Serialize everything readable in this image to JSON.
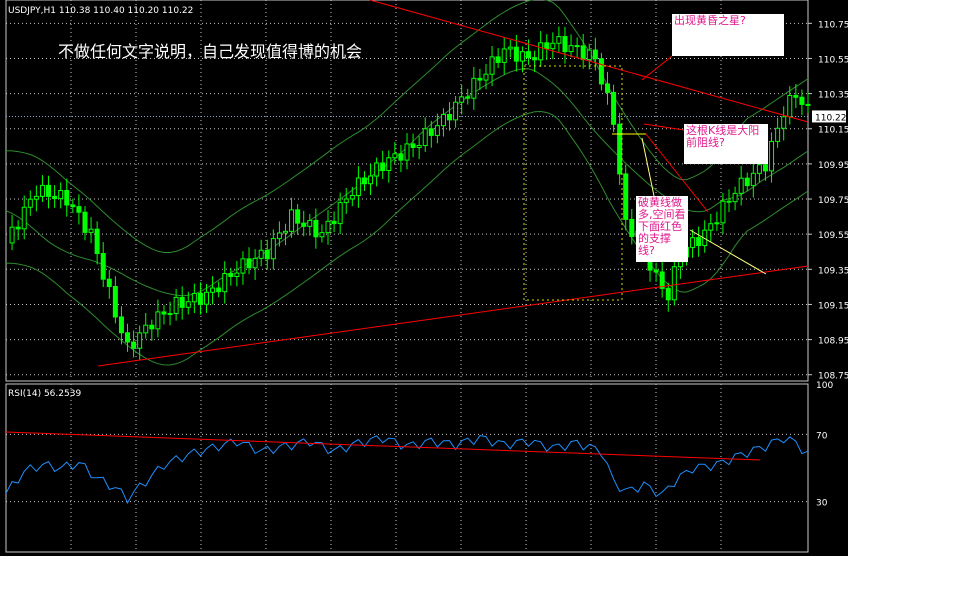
{
  "symbol_header": "USDJPY,H1  110.38 110.40 110.20 110.22",
  "headline": "不做任何文字说明，自己发现值得博的机会",
  "annotations": {
    "evening_star": "出现黄昏之星?",
    "resistance": "这根K线是大阳前阻线?",
    "support_break": "破黄线做多,空间看下面红色的支撑线?"
  },
  "price_axis": {
    "ticks": [
      "110.75",
      "110.55",
      "110.35",
      "110.15",
      "109.95",
      "109.75",
      "109.55",
      "109.35",
      "109.15",
      "108.95",
      "108.75"
    ],
    "current_price": "110.22"
  },
  "rsi_panel": {
    "label": "RSI(14) 56.2539",
    "ticks": [
      "100",
      "70",
      "30"
    ]
  },
  "colors": {
    "background": "#000000",
    "grid": "#c8c8c8",
    "candles": "#00ff00",
    "bands": "#2e8b2e",
    "trendline": "#ff0000",
    "rsi": "#1e90ff",
    "annotation_text": "#e0188c",
    "annotation_box": "#ffffff",
    "dotted_box": "#d8d800"
  },
  "chart_data": [
    {
      "type": "candlestick",
      "title": "USDJPY,H1",
      "ohlc_last": {
        "open": 110.38,
        "high": 110.4,
        "low": 110.2,
        "close": 110.22
      },
      "ylim": [
        108.72,
        110.86
      ],
      "close_path": [
        [
          0,
          109.5
        ],
        [
          5,
          109.8
        ],
        [
          10,
          109.75
        ],
        [
          14,
          109.55
        ],
        [
          18,
          109.1
        ],
        [
          20,
          108.9
        ],
        [
          24,
          109.05
        ],
        [
          28,
          109.15
        ],
        [
          33,
          109.2
        ],
        [
          38,
          109.35
        ],
        [
          43,
          109.45
        ],
        [
          47,
          109.65
        ],
        [
          52,
          109.55
        ],
        [
          57,
          109.8
        ],
        [
          62,
          109.95
        ],
        [
          67,
          110.05
        ],
        [
          72,
          110.2
        ],
        [
          77,
          110.4
        ],
        [
          82,
          110.6
        ],
        [
          86,
          110.55
        ],
        [
          90,
          110.65
        ],
        [
          94,
          110.6
        ],
        [
          97,
          110.55
        ],
        [
          100,
          110.2
        ],
        [
          102,
          109.6
        ],
        [
          104,
          109.55
        ],
        [
          107,
          109.3
        ],
        [
          109,
          109.2
        ],
        [
          111,
          109.45
        ],
        [
          115,
          109.55
        ],
        [
          120,
          109.8
        ],
        [
          125,
          109.95
        ],
        [
          128,
          110.25
        ],
        [
          130,
          110.35
        ],
        [
          132,
          110.25
        ]
      ]
    },
    {
      "type": "line",
      "title": "RSI(14)",
      "value": 56.2539,
      "ylim": [
        0,
        100
      ],
      "levels": [
        70,
        30
      ],
      "path": [
        [
          0,
          35
        ],
        [
          3,
          48
        ],
        [
          6,
          52
        ],
        [
          9,
          50
        ],
        [
          12,
          53
        ],
        [
          15,
          44
        ],
        [
          18,
          38
        ],
        [
          20,
          32
        ],
        [
          23,
          42
        ],
        [
          26,
          52
        ],
        [
          30,
          58
        ],
        [
          34,
          62
        ],
        [
          38,
          66
        ],
        [
          42,
          60
        ],
        [
          46,
          63
        ],
        [
          50,
          66
        ],
        [
          54,
          60
        ],
        [
          58,
          65
        ],
        [
          62,
          68
        ],
        [
          66,
          63
        ],
        [
          70,
          66
        ],
        [
          74,
          64
        ],
        [
          78,
          68
        ],
        [
          82,
          64
        ],
        [
          86,
          66
        ],
        [
          90,
          62
        ],
        [
          94,
          65
        ],
        [
          98,
          60
        ],
        [
          100,
          42
        ],
        [
          102,
          36
        ],
        [
          105,
          40
        ],
        [
          108,
          34
        ],
        [
          110,
          42
        ],
        [
          113,
          50
        ],
        [
          117,
          52
        ],
        [
          121,
          58
        ],
        [
          125,
          63
        ],
        [
          128,
          68
        ],
        [
          130,
          65
        ],
        [
          132,
          58
        ]
      ]
    }
  ]
}
